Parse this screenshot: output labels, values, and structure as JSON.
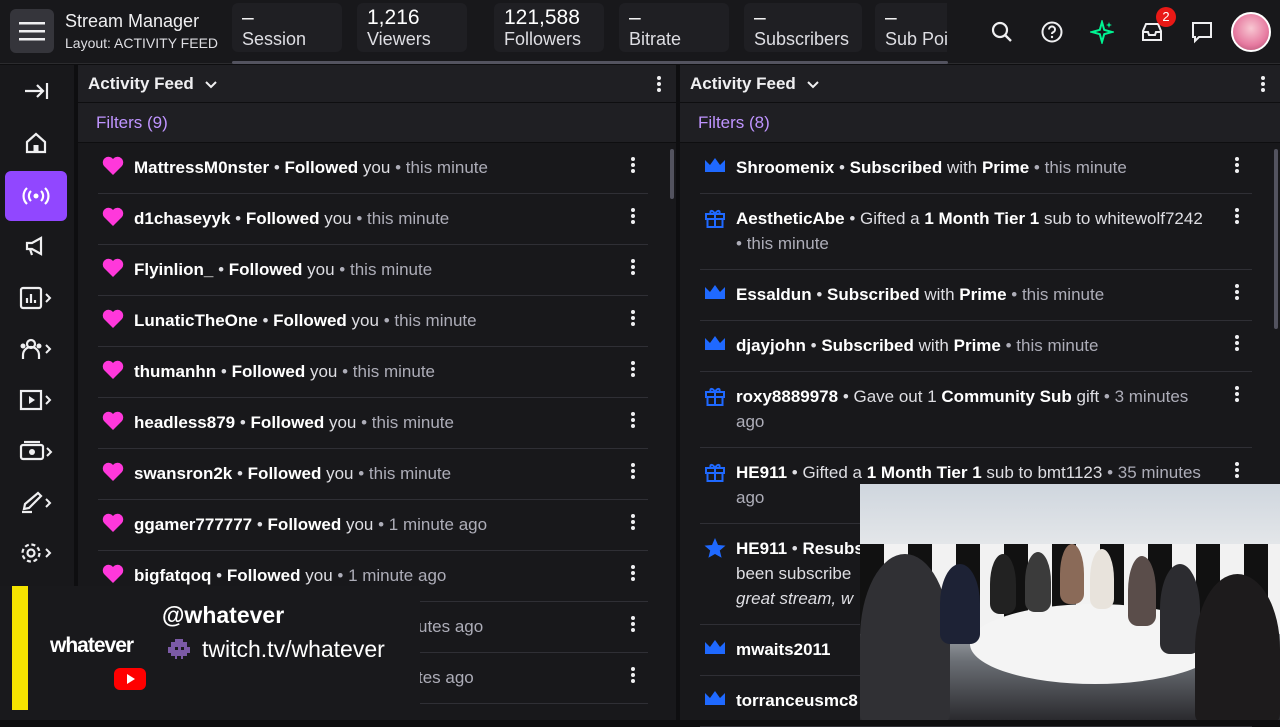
{
  "app": {
    "title": "Stream Manager",
    "layout_label": "Layout: ACTIVITY FEED"
  },
  "stats": [
    {
      "value": "–",
      "label": "Session"
    },
    {
      "value": "1,216",
      "label": "Viewers"
    },
    {
      "value": "121,588",
      "label": "Followers"
    },
    {
      "value": "–",
      "label": "Bitrate"
    },
    {
      "value": "–",
      "label": "Subscribers"
    },
    {
      "value": "–",
      "label": "Sub Poi"
    }
  ],
  "notifications_count": "2",
  "sidebar": {
    "items": [
      "expand-icon",
      "home-icon",
      "broadcast-icon",
      "megaphone-icon",
      "analytics-icon",
      "community-icon",
      "video-icon",
      "monetization-icon",
      "creator-tools-icon",
      "settings-icon"
    ]
  },
  "left_panel": {
    "title": "Activity Feed",
    "filters": "Filters (9)",
    "items": [
      {
        "user": "MattressM0nster",
        "action": "Followed",
        "rest": "you",
        "time": "this minute"
      },
      {
        "user": "d1chaseyyk",
        "action": "Followed",
        "rest": "you",
        "time": "this minute"
      },
      {
        "user": "Flyinlion_",
        "action": "Followed",
        "rest": "you",
        "time": "this minute"
      },
      {
        "user": "LunaticTheOne",
        "action": "Followed",
        "rest": "you",
        "time": "this minute"
      },
      {
        "user": "thumanhn",
        "action": "Followed",
        "rest": "you",
        "time": "this minute"
      },
      {
        "user": "headless879",
        "action": "Followed",
        "rest": "you",
        "time": "this minute"
      },
      {
        "user": "swansron2k",
        "action": "Followed",
        "rest": "you",
        "time": "this minute"
      },
      {
        "user": "ggamer777777",
        "action": "Followed",
        "rest": "you",
        "time": "1 minute ago"
      },
      {
        "user": "bigfatqoq",
        "action": "Followed",
        "rest": "you",
        "time": "1 minute ago"
      }
    ],
    "partial_times": [
      "utes ago",
      "tes ago"
    ]
  },
  "right_panel": {
    "title": "Activity Feed",
    "filters": "Filters (8)",
    "items": [
      {
        "type": "sub",
        "p1": "Shroomenix",
        "p2": "Subscribed",
        "p3": "with",
        "p4": "Prime",
        "time": "this minute"
      },
      {
        "type": "gift",
        "p1": "AestheticAbe",
        "p2": "Gifted a",
        "p3": "1 Month Tier 1",
        "p4": "sub to",
        "p5": "whitewolf7242",
        "time": "this minute"
      },
      {
        "type": "sub",
        "p1": "Essaldun",
        "p2": "Subscribed",
        "p3": "with",
        "p4": "Prime",
        "time": "this minute"
      },
      {
        "type": "sub",
        "p1": "djayjohn",
        "p2": "Subscribed",
        "p3": "with",
        "p4": "Prime",
        "time": "this minute"
      },
      {
        "type": "gift",
        "p1": "roxy8889978",
        "p2": "Gave out 1",
        "p3": "Community Sub",
        "p4": "gift",
        "time": "3 minutes ago"
      },
      {
        "type": "gift",
        "p1": "HE911",
        "p2": "Gifted a",
        "p3": "1 Month Tier 1",
        "p4": "sub to bmt1123",
        "time": "35 minutes ago"
      }
    ],
    "resub": {
      "user": "HE911",
      "action": "Resubs",
      "line2": "been subscribe",
      "message": "great stream, w"
    },
    "more": [
      "mwaits2011",
      "torranceusmc8"
    ]
  },
  "overlay": {
    "logo": "whatever",
    "handle": "@whatever",
    "url": "twitch.tv/whatever"
  },
  "colors": {
    "accent": "#9147ff",
    "heart": "#ff38db",
    "sub_icon": "#1f69ff",
    "filters": "#bf94ff",
    "badge": "#e91916",
    "overlay_bar": "#f5e400"
  }
}
